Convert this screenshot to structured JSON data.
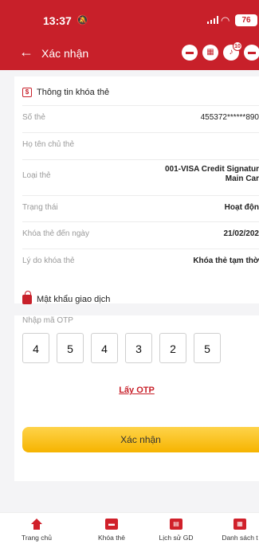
{
  "status_bar": {
    "time": "13:37",
    "battery": "76"
  },
  "nav": {
    "title": "Xác nhận",
    "notif_count": "10"
  },
  "card_info": {
    "section_title": "Thông tin khóa thẻ",
    "rows": [
      {
        "label": "Số thẻ",
        "value": "455372******890",
        "bold": false
      },
      {
        "label": "Họ tên chủ thẻ",
        "value": "",
        "bold": false
      },
      {
        "label": "Loại thẻ",
        "value": "001-VISA Credit Signatur",
        "value2": "Main Car",
        "bold": true
      },
      {
        "label": "Trạng thái",
        "value": "Hoạt độn",
        "bold": true
      },
      {
        "label": "Khóa thẻ đến ngày",
        "value": "21/02/202",
        "bold": true
      },
      {
        "label": "Lý do khóa thẻ",
        "value": "Khóa thẻ tạm thờ",
        "bold": true
      }
    ]
  },
  "otp": {
    "section_title": "Mật khẩu giao dịch",
    "hint": "Nhập mã OTP",
    "digits": [
      "4",
      "5",
      "4",
      "3",
      "2",
      "5"
    ],
    "get_otp_label": "Lấy OTP"
  },
  "confirm_label": "Xác nhận",
  "tabs": [
    {
      "label": "Trang chủ",
      "icon": "home-icon"
    },
    {
      "label": "Khóa thẻ",
      "icon": "card-lock-icon"
    },
    {
      "label": "Lịch sử GD",
      "icon": "history-icon"
    },
    {
      "label": "Danh sách t",
      "icon": "list-icon"
    }
  ],
  "colors": {
    "brand": "#c8202a",
    "accent": "#f6b400"
  }
}
